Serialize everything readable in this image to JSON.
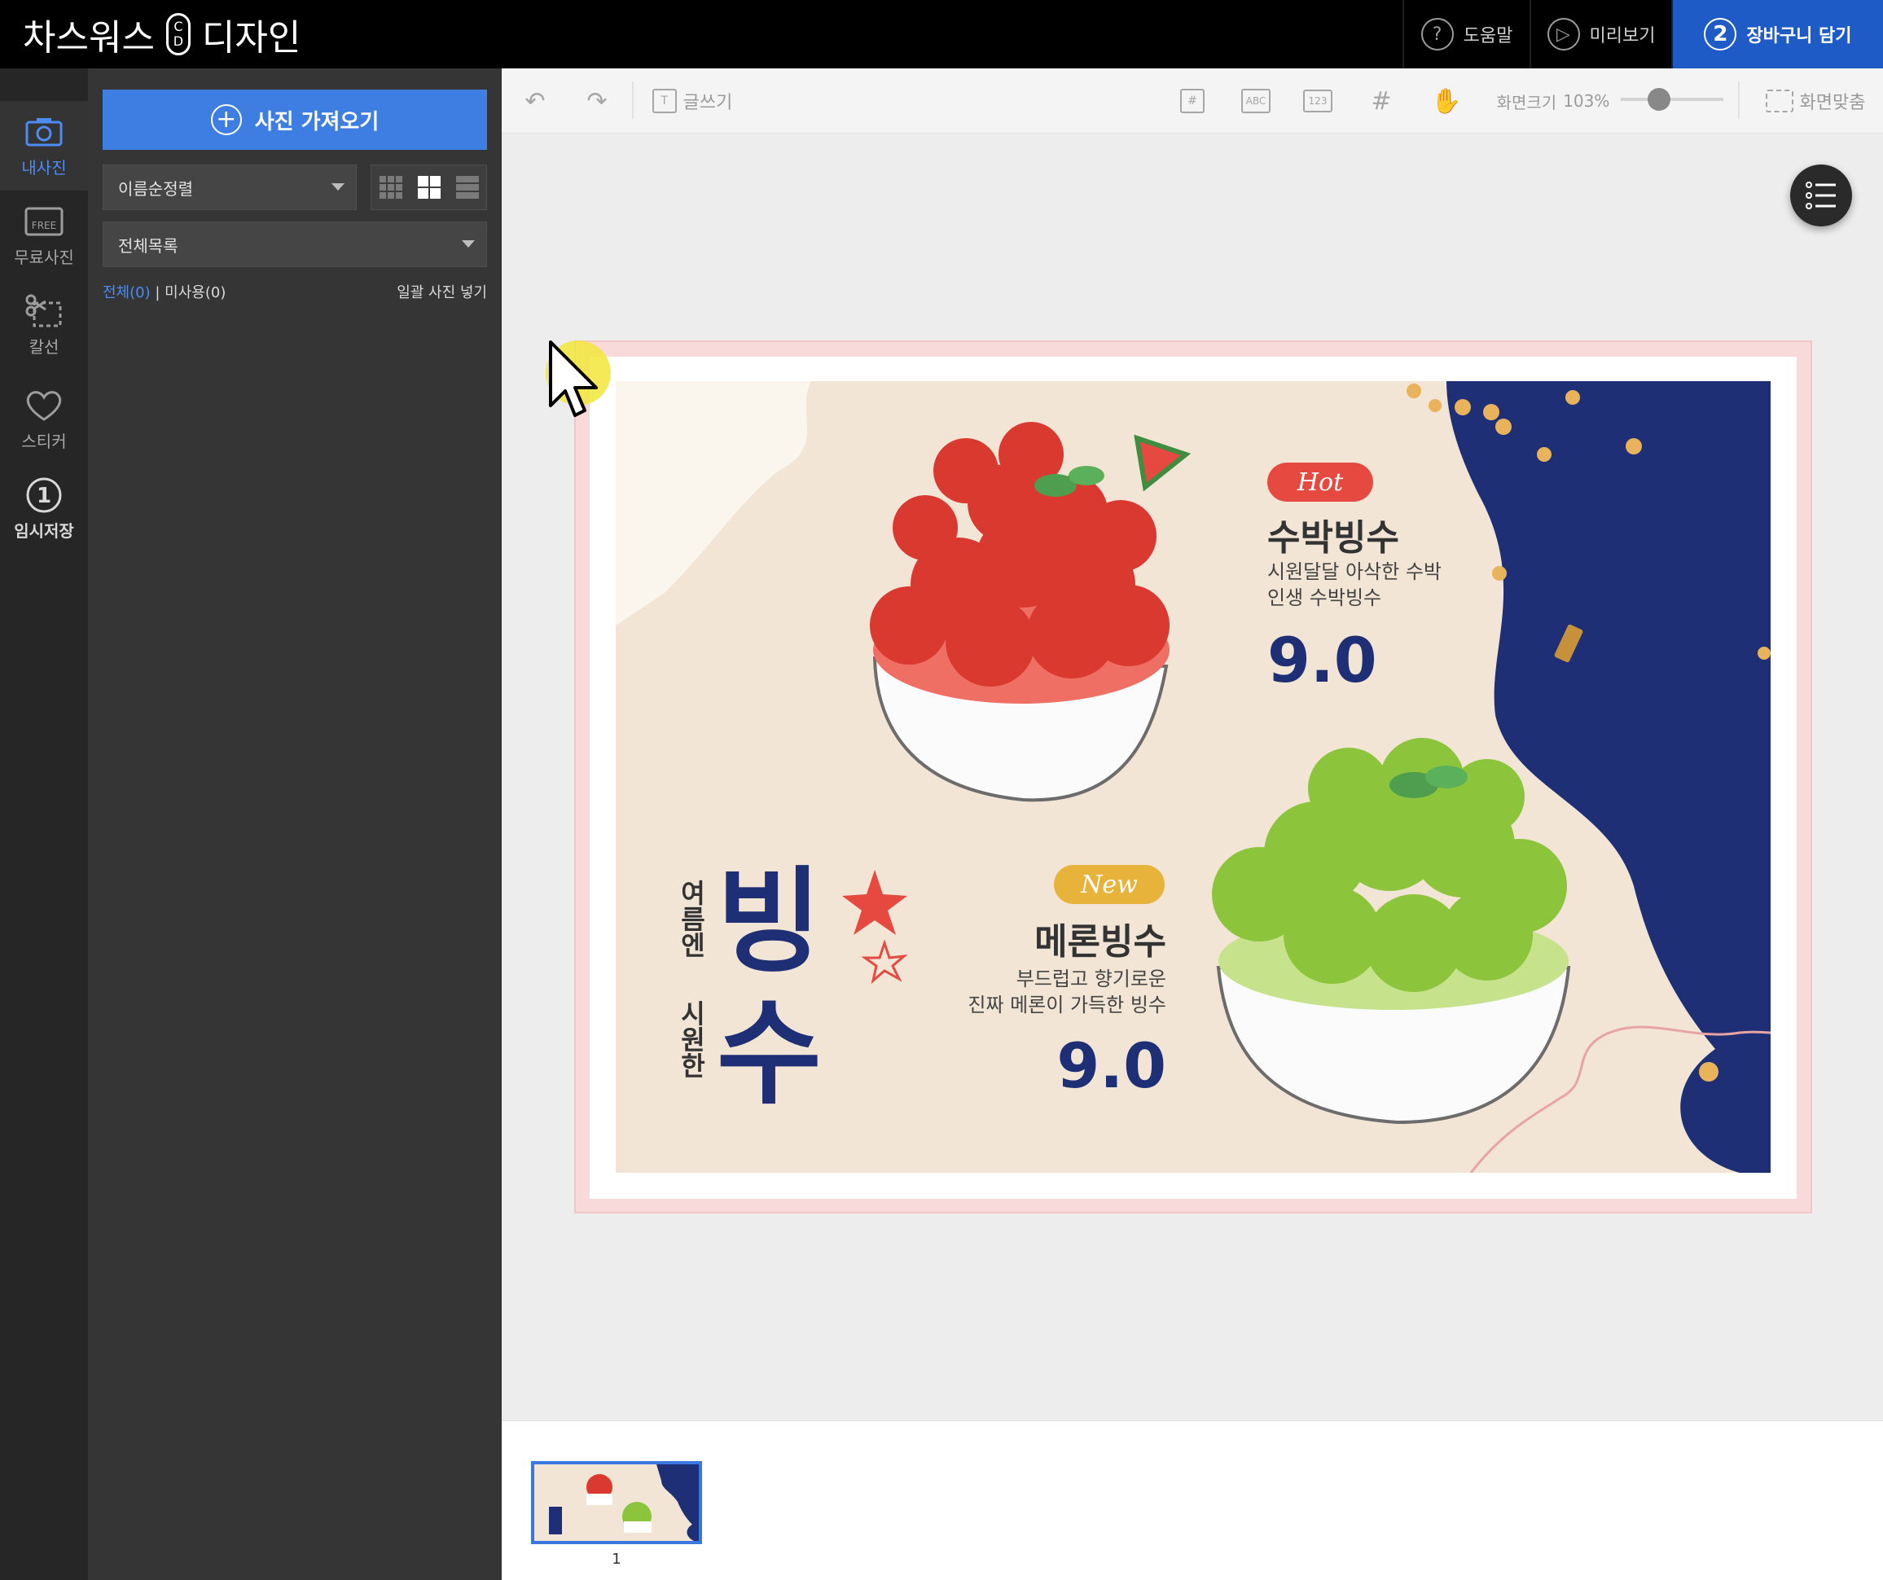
{
  "app": {
    "logo_left": "차스워스",
    "logo_c": "C",
    "logo_d": "D",
    "logo_right": "디자인"
  },
  "topbar": {
    "help_label": "도움말",
    "preview_label": "미리보기",
    "cart_step": "2",
    "cart_label": "장바구니 담기"
  },
  "rail": {
    "items": [
      {
        "label": "내사진"
      },
      {
        "label": "무료사진",
        "badge": "FREE"
      },
      {
        "label": "칼선"
      },
      {
        "label": "스티커"
      },
      {
        "label": "임시저장",
        "step": "1"
      }
    ]
  },
  "panel": {
    "import_label": "사진 가져오기",
    "sort_value": "이름순정렬",
    "list_value": "전체목록",
    "filter_all": "전체(0)",
    "filter_divider": "|",
    "filter_unused": "미사용(0)",
    "bulk_insert": "일괄 사진 넣기"
  },
  "toolbar": {
    "text_label": "글쓰기",
    "abc_label": "ABC",
    "num_label": "123",
    "zoom_label": "화면크기",
    "zoom_value": "103%",
    "fit_label": "화면맞춤"
  },
  "zoom": {
    "level": 0.29
  },
  "poster": {
    "hot_badge": "Hot",
    "title1": "수박빙수",
    "desc1_line1": "시원달달 아삭한 수박",
    "desc1_line2": "인생 수박빙수",
    "price1": "9.0",
    "new_badge": "New",
    "title2": "메론빙수",
    "desc2_line1": "부드럽고 향기로운",
    "desc2_line2": "진짜 메론이 가득한 빙수",
    "price2": "9.0",
    "vertical_left1": "여름엔",
    "vertical_left2": "시원한",
    "big_1": "빙",
    "big_2": "수",
    "colors": {
      "navy": "#1e2f75",
      "red": "#e5493f",
      "green": "#8cc43c",
      "cream": "#f2e5d6",
      "gold": "#e8b33a"
    }
  },
  "pages": {
    "current": "1"
  }
}
